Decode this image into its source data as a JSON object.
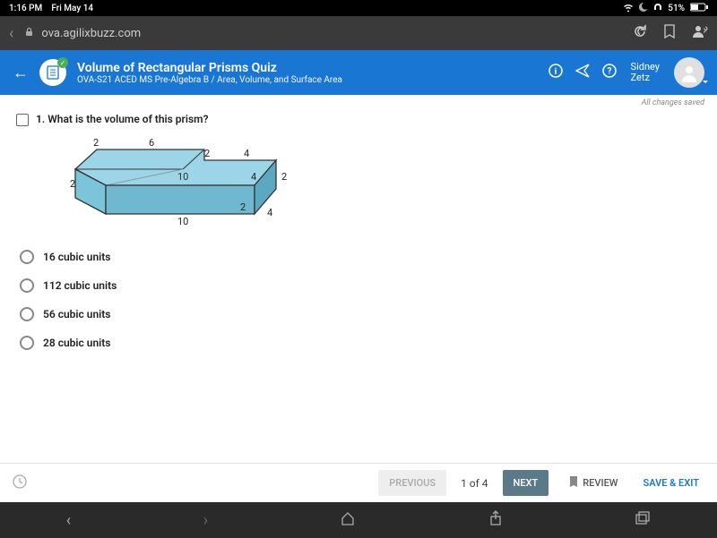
{
  "status": {
    "time": "1:16 PM",
    "day": "Fri May 14",
    "battery": "51%"
  },
  "url": "ova.agilixbuzz.com",
  "header": {
    "title": "Volume of Rectangular Prisms Quiz",
    "subtitle": "OVA-S21 ACED MS Pre-Algebra B / Area, Volume, and Surface Area",
    "user_first": "Sidney",
    "user_last": "Zetz"
  },
  "save_status": "All changes saved",
  "question": {
    "number": "1.",
    "text": "What is the volume of this prism?",
    "dimensions": {
      "a": "2",
      "b": "6",
      "c": "2",
      "d": "4",
      "e": "2",
      "f": "10",
      "g": "4",
      "h": "2",
      "i": "10",
      "j": "2",
      "k": "4"
    }
  },
  "choices": [
    "16 cubic units",
    "112 cubic units",
    "56 cubic units",
    "28 cubic units"
  ],
  "footer": {
    "previous": "PREVIOUS",
    "pager": "1 of 4",
    "next": "NEXT",
    "review": "REVIEW",
    "save_exit": "SAVE & EXIT"
  }
}
